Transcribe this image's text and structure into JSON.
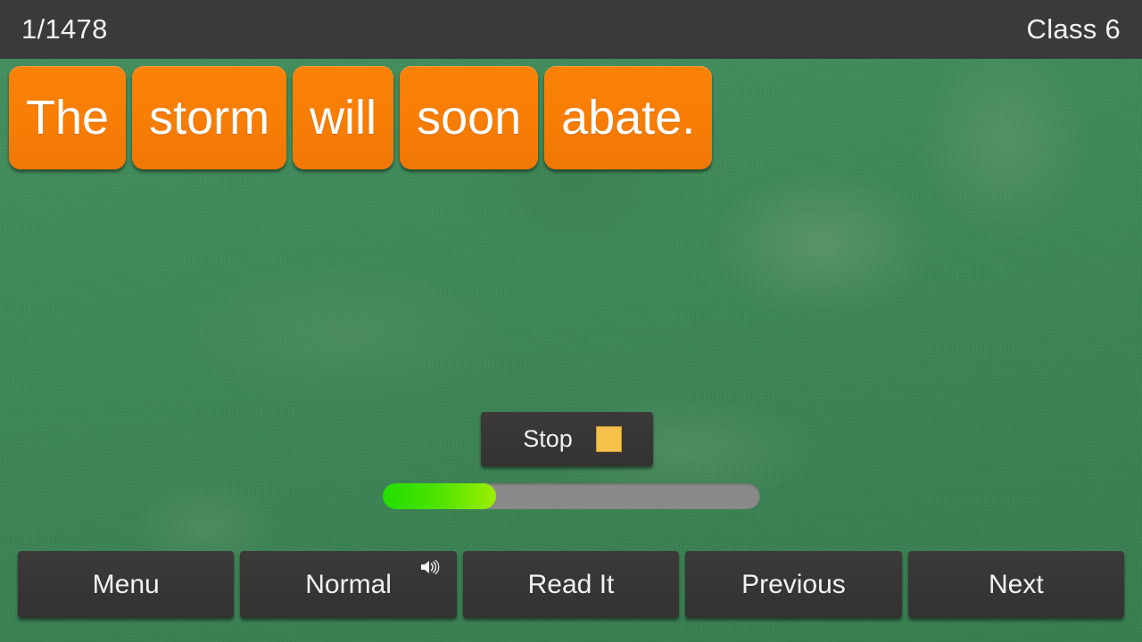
{
  "header": {
    "counter": "1/1478",
    "class_label": "Class 6"
  },
  "sentence": {
    "full_text": "The storm will soon abate.",
    "tiles": [
      {
        "word": "The"
      },
      {
        "word": "storm"
      },
      {
        "word": "will"
      },
      {
        "word": "soon"
      },
      {
        "word": "abate."
      }
    ]
  },
  "playback": {
    "stop_label": "Stop",
    "stop_icon": "stop-square-icon",
    "progress_percent": 30
  },
  "bottom_bar": {
    "buttons": [
      {
        "label": "Menu",
        "icon": null
      },
      {
        "label": "Normal",
        "icon": "speaker-volume-icon"
      },
      {
        "label": "Read It",
        "icon": null
      },
      {
        "label": "Previous",
        "icon": null
      },
      {
        "label": "Next",
        "icon": null
      }
    ]
  },
  "colors": {
    "board_green": "#3e8a5a",
    "header_dark": "#3a3a3a",
    "tile_orange": "#f87e06",
    "button_dark": "#3a3837",
    "stop_square_amber": "#f4c14a",
    "progress_track_gray": "#8a8a8a",
    "progress_fill_green_start": "#22dd00",
    "progress_fill_green_end": "#9cee00",
    "text_white": "#f2f2f2"
  }
}
